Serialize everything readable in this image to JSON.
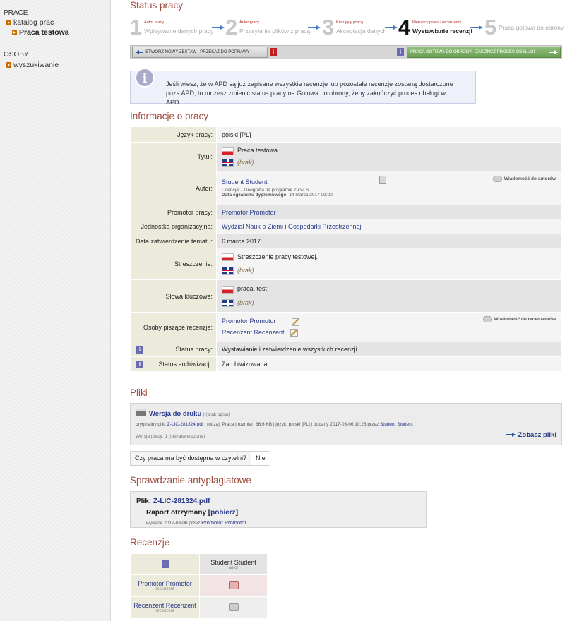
{
  "sidebar": {
    "section_prace": "PRACE",
    "katalog": "katalog prac",
    "praca_testowa": "Praca testowa",
    "section_osoby": "OSOBY",
    "wyszukiwanie": "wyszukiwanie"
  },
  "status": {
    "title": "Status pracy",
    "steps": [
      {
        "num": "1",
        "who": "Autor pracy",
        "what": "Wpisywanie danych pracy"
      },
      {
        "num": "2",
        "who": "Autor pracy",
        "what": "Przesyłanie plików z pracą"
      },
      {
        "num": "3",
        "who": "Kierujący pracą",
        "what": "Akceptacja danych"
      },
      {
        "num": "4",
        "who": "Kierujący pracą i recenzenci",
        "what": "Wystawianie recenzji"
      },
      {
        "num": "5",
        "who": "",
        "what": "Praca gotowa do obrony"
      }
    ],
    "btn_back": "Stwórz nowy zestaw i przekaż do poprawy",
    "btn_done": "Praca gotowa do obrony - zakończ proces obsługi",
    "info_text": "Jeśli wiesz, że w APD są już zapisane wszystkie recenzje lub pozostałe recenzje zostaną dostarczone poza APD, to możesz zmienić status pracy na Gotowa do obrony, żeby zakończyć proces obsługi w APD."
  },
  "informacje": {
    "title": "Informacje o pracy",
    "jezyk_label": "Język pracy:",
    "jezyk_value": "polski [PL]",
    "tytul_label": "Tytuł:",
    "tytul_pl": "Praca testowa",
    "tytul_en": "(brak)",
    "autor_label": "Autor:",
    "autor_name": "Student Student",
    "autor_msg": "Wiadomość do autorów",
    "autor_program": "Licencjat - Geografia na programie Z-G-LS",
    "autor_exam_label": "Data egzaminu dyplomowego:",
    "autor_exam_date": "14 marca 2017 09:00",
    "promotor_label": "Promotor pracy:",
    "promotor_value": "Promotor Promotor",
    "jednostka_label": "Jednostka organizacyjna:",
    "jednostka_value": "Wydział Nauk o Ziemi i Gospodarki Przestrzennej",
    "data_label": "Data zatwierdzenia tematu:",
    "data_value": "6 marca 2017",
    "streszczenie_label": "Streszczenie:",
    "streszczenie_pl": "Streszczenie pracy testowej.",
    "streszczenie_en": "(brak)",
    "slowa_label": "Słowa kluczowe:",
    "slowa_pl": "praca, test",
    "slowa_en": "(brak)",
    "osoby_label": "Osoby piszące recenzje:",
    "osoby_1": "Promotor Promotor",
    "osoby_2": "Recenzent Recenzent",
    "osoby_msg": "Wiadomość do recenzentów",
    "status_label": "Status pracy:",
    "status_value": "Wystawianie i zatwierdzenie wszystkich recenzji",
    "arch_label": "Status archiwizacji:",
    "arch_value": "Zarchiwizowana",
    "info_icon": "i"
  },
  "pliki": {
    "title": "Pliki",
    "wersja": "Wersja do druku",
    "brak_opisu": "| (brak opisu)",
    "meta_prefix": "oryginalny plik:",
    "meta_file": "Z-LIC-281324.pdf",
    "meta_mid": "| rodzaj: Praca | rozmiar: 36,6 KB | język: polski [PL] | dodany 2017-03-06 10:26 przez",
    "meta_by": "Student Student",
    "wersja_pracy": "Wersja pracy: 1 (niezatwierdzona)",
    "zobacz": "Zobacz pliki",
    "czytelnia_q": "Czy praca ma być dostępna w czytelni?",
    "czytelnia_a": "Nie"
  },
  "anti": {
    "title": "Sprawdzanie antyplagiatowe",
    "plik_label": "Plik:",
    "plik_name": "Z-LIC-281324.pdf",
    "raport": "Raport otrzymany",
    "pobierz": "pobierz",
    "wyslane": "wysłane 2017-03-06 przez",
    "wyslane_by": "Promotor Promotor"
  },
  "recenzje": {
    "title": "Recenzje",
    "student": "Student Student",
    "student_role": "autor",
    "r1": "Promotor Promotor",
    "r1_role": "recenzent",
    "r2": "Recenzent Recenzent",
    "r2_role": "recenzent"
  }
}
